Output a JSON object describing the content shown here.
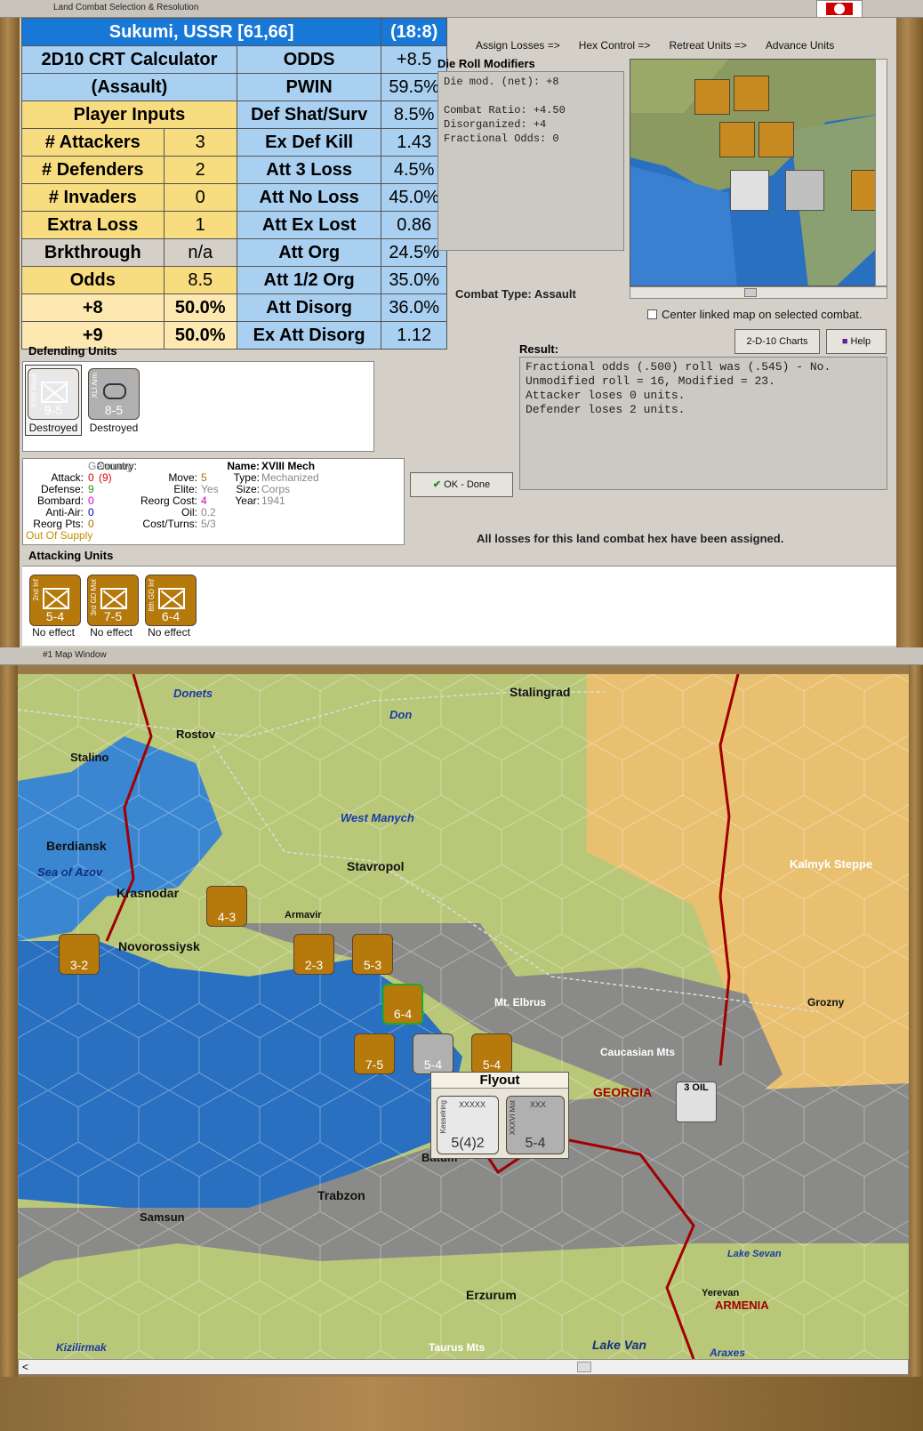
{
  "combat_window": {
    "title": "Land Combat Selection & Resolution",
    "tabs": [
      "Assign Losses =>",
      "Hex Control =>",
      "Retreat Units =>",
      "Advance Units"
    ],
    "crt": {
      "location": "Sukumi, USSR [61,66]",
      "ratio": "(18:8)",
      "calc1": "2D10 CRT Calculator",
      "calc2": "(Assault)",
      "player_inputs": "Player Inputs",
      "left_rows": [
        {
          "label": "# Attackers",
          "value": "3"
        },
        {
          "label": "# Defenders",
          "value": "2"
        },
        {
          "label": "# Invaders",
          "value": "0"
        },
        {
          "label": "Extra Loss",
          "value": "1"
        },
        {
          "label": "Brkthrough",
          "value": "n/a"
        },
        {
          "label": "Odds",
          "value": "8.5"
        },
        {
          "label": "+8",
          "value": "50.0%"
        },
        {
          "label": "+9",
          "value": "50.0%"
        }
      ],
      "right_rows": [
        {
          "label": "ODDS",
          "value": "+8.5"
        },
        {
          "label": "PWIN",
          "value": "59.5%"
        },
        {
          "label": "Def Shat/Surv",
          "value": "8.5%"
        },
        {
          "label": "Ex Def Kill",
          "value": "1.43"
        },
        {
          "label": "Att 3 Loss",
          "value": "4.5%"
        },
        {
          "label": "Att No Loss",
          "value": "45.0%"
        },
        {
          "label": "Att Ex Lost",
          "value": "0.86"
        },
        {
          "label": "Att Org",
          "value": "24.5%"
        },
        {
          "label": "Att 1/2 Org",
          "value": "35.0%"
        },
        {
          "label": "Att Disorg",
          "value": "36.0%"
        },
        {
          "label": "Ex Att Disorg",
          "value": "1.12"
        }
      ]
    },
    "die_roll": {
      "heading": "Die Roll Modifiers",
      "lines": [
        "Die mod. (net): +8",
        "",
        "Combat Ratio: +4.50",
        "Disorganized: +4",
        "Fractional Odds: 0"
      ]
    },
    "combat_type": "Combat Type:  Assault",
    "center_linked": "Center linked map on selected combat.",
    "charts_button": "2-D-10 Charts",
    "help_button": "Help",
    "result_label": "Result:",
    "result_lines": [
      "Fractional odds (.500) roll was (.545)  - No.",
      "Unmodified roll = 16, Modified = 23.",
      "Attacker loses 0 units.",
      "Defender loses 2 units."
    ],
    "ok_button": "OK - Done",
    "all_losses": "All losses for this land combat hex have been assigned.",
    "defending_label": "Defending Units",
    "defenders": [
      {
        "name": "XVIII Mech",
        "size": "XXX",
        "strength": "9-5",
        "status": "Destroyed"
      },
      {
        "name": "XLI Arm",
        "size": "XXX",
        "strength": "8-5",
        "status": "Destroyed"
      }
    ],
    "attacking_label": "Attacking Units",
    "attackers": [
      {
        "name": "2nd Inf",
        "size": "XXXX",
        "strength": "5-4",
        "status": "No effect"
      },
      {
        "name": "3rd GD Mot",
        "size": "XXX",
        "strength": "7-5",
        "status": "No effect"
      },
      {
        "name": "8th GD Inf",
        "size": "XXXX",
        "strength": "6-4",
        "status": "No effect"
      }
    ],
    "unit_info": {
      "country_l": "Country:",
      "country_v": "Germany",
      "attack_l": "Attack:",
      "attack_v": "0",
      "attack_v2": "(9)",
      "defense_l": "Defense:",
      "defense_v": "9",
      "bombard_l": "Bombard:",
      "bombard_v": "0",
      "antiair_l": "Anti-Air:",
      "antiair_v": "0",
      "reorg_l": "Reorg Pts:",
      "reorg_v": "0",
      "supply": "Out Of Supply",
      "move_l": "Move:",
      "move_v": "5",
      "elite_l": "Elite:",
      "elite_v": "Yes",
      "reorgcost_l": "Reorg Cost:",
      "reorgcost_v": "4",
      "oil_l": "Oil:",
      "oil_v": "0.2",
      "cost_l": "Cost/Turns:",
      "cost_v": "5/3",
      "name_l": "Name:",
      "name_v": "XVIII Mech",
      "type_l": "Type:",
      "type_v": "Mechanized",
      "size_l": "Size:",
      "size_v": "Corps",
      "year_l": "Year:",
      "year_v": "1941"
    }
  },
  "map_window": {
    "title": "#1 Map Window",
    "labels": {
      "donets": "Donets",
      "stalingrad": "Stalingrad",
      "don": "Don",
      "rostov": "Rostov",
      "stalino": "Stalino",
      "west_manych": "West Manych",
      "berdiansk": "Berdiansk",
      "sea_azov": "Sea of Azov",
      "stavropol": "Stavropol",
      "kalmyk": "Kalmyk Steppe",
      "krasnodar": "Krasnodar",
      "armavir": "Armavir",
      "novorossiysk": "Novorossiysk",
      "elbrus": "Mt. Elbrus",
      "grozny": "Grozny",
      "caucasian": "Caucasian Mts",
      "georgia": "GEORGIA",
      "batum": "Batum",
      "trabzon": "Trabzon",
      "samsun": "Samsun",
      "lake_sevan": "Lake Sevan",
      "yerevan": "Yerevan",
      "armenia": "ARMENIA",
      "erzurum": "Erzurum",
      "kizilirmak": "Kizilirmak",
      "taurus": "Taurus Mts",
      "lake_van": "Lake Van",
      "araxes": "Araxes",
      "oil": "3 OIL"
    },
    "flyout": {
      "title": "Flyout",
      "u1_name": "Kesselring",
      "u1_size": "XXXXX",
      "u1_str": "5(4)2",
      "u2_name": "XXXVI Mot",
      "u2_size": "XXX",
      "u2_str": "5-4"
    },
    "map_units": [
      {
        "str": "4-3"
      },
      {
        "str": "2-3"
      },
      {
        "str": "5-3"
      },
      {
        "str": "3-2"
      },
      {
        "str": "6-4"
      },
      {
        "str": "7-5"
      },
      {
        "str": "5-4"
      },
      {
        "str": "5-4"
      }
    ]
  },
  "colors": {
    "header": "#1878d8",
    "blue_cell": "#a9d0f0",
    "yellow_cell": "#f8dc80",
    "unit_brown": "#b5790c",
    "sea": "#2a70c0",
    "plain": "#b8c878",
    "steppe": "#e8c070"
  }
}
